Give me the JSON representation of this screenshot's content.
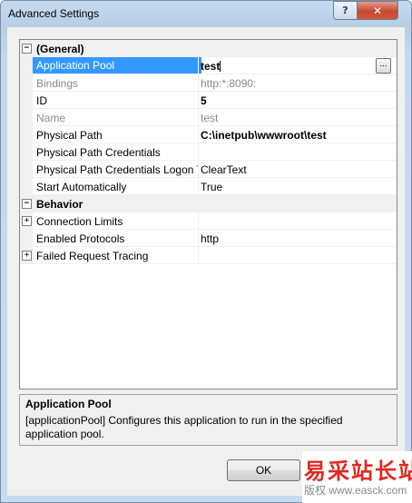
{
  "window": {
    "title": "Advanced Settings"
  },
  "titlebar": {
    "help_glyph": "?",
    "close_glyph": "✕"
  },
  "grid": {
    "general": {
      "expander": "−",
      "label": "(General)"
    },
    "app_pool": {
      "label": "Application Pool",
      "value": "test",
      "ellipsis": "..."
    },
    "bindings": {
      "label": "Bindings",
      "value": "http:*:8090:"
    },
    "id": {
      "label": "ID",
      "value": "5"
    },
    "name": {
      "label": "Name",
      "value": "test"
    },
    "physical_path": {
      "label": "Physical Path",
      "value": "C:\\inetpub\\wwwroot\\test"
    },
    "path_credentials": {
      "label": "Physical Path Credentials",
      "value": ""
    },
    "path_logon": {
      "label": "Physical Path Credentials Logon Type",
      "value": "ClearText"
    },
    "start_auto": {
      "label": "Start Automatically",
      "value": "True"
    },
    "behavior": {
      "expander": "−",
      "label": "Behavior"
    },
    "connection_limits": {
      "expander": "+",
      "label": "Connection Limits",
      "value": ""
    },
    "enabled_protocols": {
      "label": "Enabled Protocols",
      "value": "http"
    },
    "failed_tracing": {
      "expander": "+",
      "label": "Failed Request Tracing",
      "value": ""
    }
  },
  "description": {
    "title": "Application Pool",
    "text": "[applicationPool] Configures this application to run in the specified application pool."
  },
  "buttons": {
    "ok": "OK"
  },
  "watermark": {
    "main": "易采站长站",
    "sub": "版权 www.easck.com"
  }
}
